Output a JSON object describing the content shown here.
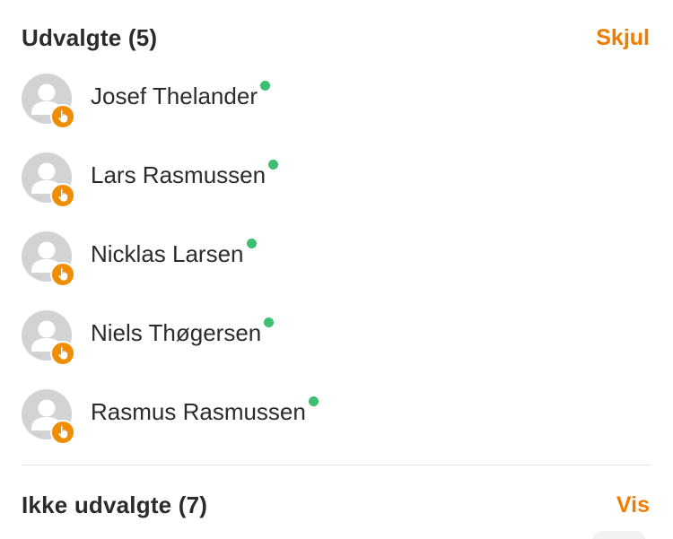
{
  "selected": {
    "title": "Udvalgte",
    "count": "(5)",
    "toggle_label": "Skjul",
    "people": [
      {
        "name": "Josef Thelander"
      },
      {
        "name": "Lars Rasmussen"
      },
      {
        "name": "Nicklas Larsen"
      },
      {
        "name": "Niels Thøgersen"
      },
      {
        "name": "Rasmus Rasmussen"
      }
    ]
  },
  "not_selected": {
    "title": "Ikke udvalgte",
    "count": "(7)",
    "toggle_label": "Vis"
  },
  "colors": {
    "accent": "#f07d00",
    "online": "#3cbf73",
    "avatar_bg": "#d3d3d3",
    "badge": "#f08c00"
  },
  "icons": {
    "avatar": "person-silhouette-icon",
    "badge": "hand-pointer-icon",
    "status": "online-dot-icon"
  }
}
